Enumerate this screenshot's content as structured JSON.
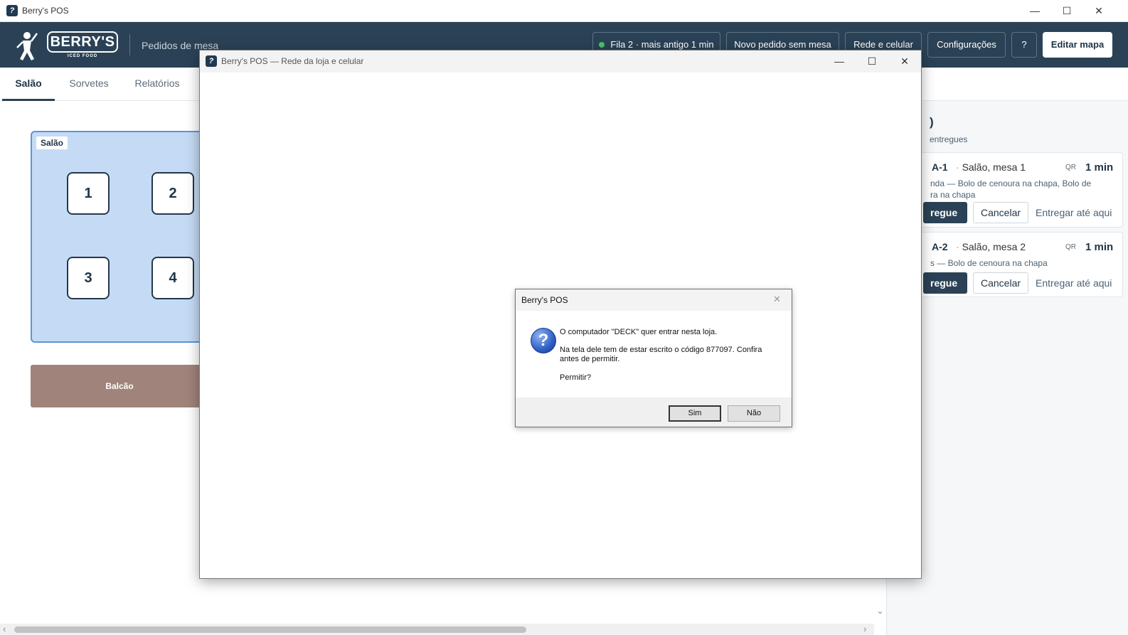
{
  "window": {
    "title": "Berry's POS",
    "app_icon_glyph": "?"
  },
  "header": {
    "logo_text": "BERRY'S",
    "logo_sub": "ICED FOOD",
    "title": "Pedidos de mesa",
    "queue_status": "Fila 2 · mais antigo 1 min",
    "new_order_label": "Novo pedido sem mesa",
    "network_label": "Rede e celular",
    "settings_label": "Configurações",
    "help_label": "?",
    "edit_map_label": "Editar mapa"
  },
  "tabs": [
    {
      "label": "Salão",
      "active": true
    },
    {
      "label": "Sorvetes",
      "active": false
    },
    {
      "label": "Relatórios",
      "active": false
    }
  ],
  "floor": {
    "label": "Salão",
    "tables": [
      "1",
      "2",
      "3",
      "4"
    ],
    "counter_label": "Balcão"
  },
  "orders_panel": {
    "title_fragment": ")",
    "subtitle_fragment": "entregues",
    "orders": [
      {
        "id": "A-1",
        "location": "Salão, mesa 1",
        "qr": "QR",
        "time": "1 min",
        "items_line1": "nda — Bolo de cenoura na chapa, Bolo de",
        "items_line2": "ra na chapa",
        "deliver_label": "regue",
        "cancel_label": "Cancelar",
        "deliver_here_label": "Entregar até aqui"
      },
      {
        "id": "A-2",
        "location": "Salão, mesa 2",
        "qr": "QR",
        "time": "1 min",
        "items_line1": "s — Bolo de cenoura na chapa",
        "deliver_label": "regue",
        "cancel_label": "Cancelar",
        "deliver_here_label": "Entregar até aqui"
      }
    ]
  },
  "modal": {
    "title": "Berry's POS — Rede da loja e celular"
  },
  "dialog": {
    "title": "Berry's POS",
    "line1": "O computador \"DECK\" quer entrar nesta loja.",
    "line2": "Na tela dele tem de estar escrito o código 877097. Confira antes de permitir.",
    "line3": "Permitir?",
    "yes_label": "Sim",
    "no_label": "Não"
  },
  "controls": {
    "minimize": "—",
    "maximize": "☐",
    "close": "✕",
    "scroll_down": "⌄",
    "scroll_left": "‹",
    "scroll_right": "›"
  }
}
